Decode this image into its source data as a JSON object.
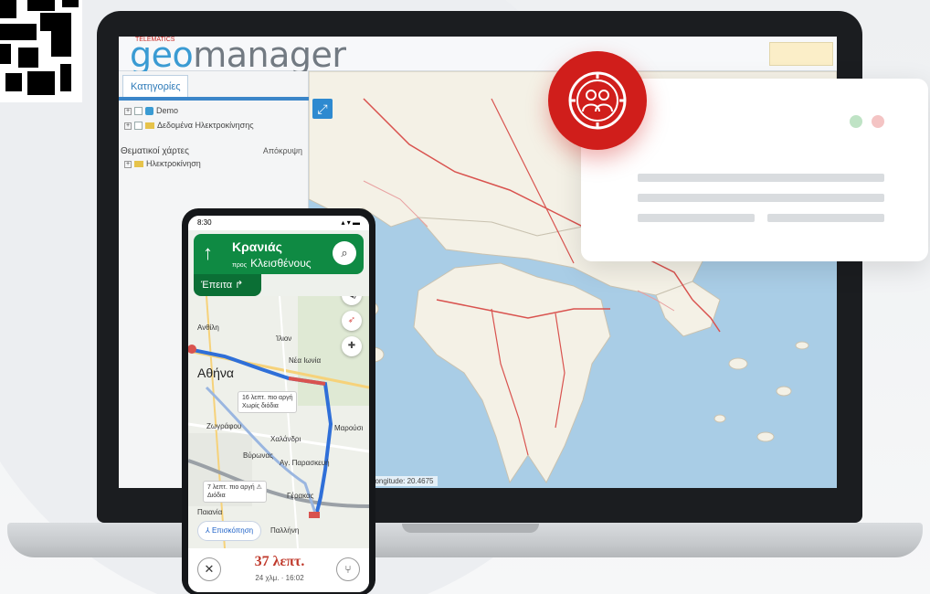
{
  "app": {
    "logo_prefix": "geo",
    "logo_suffix": "manager",
    "logo_tag": "TELEMATICS"
  },
  "sidebar": {
    "tab_label": "Κατηγορίες",
    "tree": [
      {
        "label": "Demo"
      },
      {
        "label": "Δεδομένα Ηλεκτροκίνησης"
      }
    ],
    "thematic_title": "Θεματικοί χάρτες",
    "hide_label": "Απόκρυψη",
    "thematic_items": [
      {
        "label": "Ηλεκτροκίνηση"
      }
    ]
  },
  "map": {
    "coord_readout": "Longitude: 20.4675",
    "expand_icon": "expand-icon",
    "road_color": "#d9534f",
    "land_color": "#f4f1e6",
    "sea_color": "#a9cde6"
  },
  "badge": {
    "icon": "users-circle-icon",
    "color": "#d01e1b"
  },
  "float_card": {
    "dot_colors": [
      "#bfe3c5",
      "#f4c4c4"
    ]
  },
  "phone": {
    "status_time": "8:30",
    "status_icons": "▴ ▾ ▬",
    "nav": {
      "arrow": "↑",
      "street": "Κρανιάς",
      "toward_prefix": "προς",
      "toward": "Κλεισθένους",
      "then_label": "Έπειτα ↱"
    },
    "map_labels": {
      "city": "Αθήνα",
      "places": [
        "Ανθίλη",
        "Ίλιον",
        "Νέα Ιωνία",
        "Χαλάνδρι",
        "Μαρούσι",
        "Αγ. Παρασκευή",
        "Γέρακας",
        "Παιανία",
        "Παλλήνη",
        "Ζωγράφου",
        "Βύρωνας"
      ]
    },
    "route_hints": [
      {
        "line1": "16 λεπτ. πιο αργή",
        "line2": "Χωρίς διόδια"
      },
      {
        "line1": "7 λεπτ. πιο αργή ⚠",
        "line2": "Διόδια"
      }
    ],
    "overview_label": "⅄ Επισκόπηση",
    "eta": "37 λεπτ.",
    "eta_sub": "24 χλμ. · 16:02",
    "route_color": "#2f6fd8",
    "traffic_color": "#d9534f"
  }
}
